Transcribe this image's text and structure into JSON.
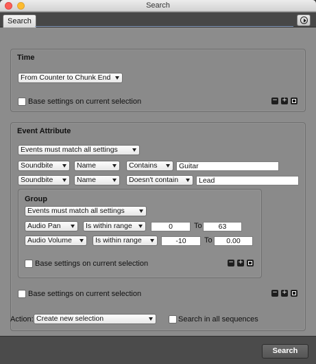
{
  "window": {
    "title": "Search"
  },
  "tab": {
    "label": "Search"
  },
  "time": {
    "title": "Time",
    "range_select": "From Counter to Chunk End",
    "base_settings_label": "Base settings on current selection"
  },
  "event_attribute": {
    "title": "Event Attribute",
    "match_select": "Events must match all settings",
    "rows": [
      {
        "type": "Soundbite",
        "field": "Name",
        "operator": "Contains",
        "value": "Guitar"
      },
      {
        "type": "Soundbite",
        "field": "Name",
        "operator": "Doesn't contain",
        "value": "Lead"
      }
    ],
    "base_settings_label": "Base settings on current selection"
  },
  "group": {
    "title": "Group",
    "match_select": "Events must match all settings",
    "rows": [
      {
        "param": "Audio Pan",
        "condition": "Is within range",
        "from": "0",
        "to_label": "To",
        "to": "63"
      },
      {
        "param": "Audio Volume",
        "condition": "Is within range",
        "from": "-10",
        "to_label": "To",
        "to": "0.00"
      }
    ],
    "base_settings_label": "Base settings on current selection"
  },
  "action": {
    "label": "Action:",
    "select": "Create new selection",
    "search_all_label": "Search in all sequences"
  },
  "footer": {
    "search_button": "Search"
  },
  "icons": {
    "minus": "−",
    "plus": "+"
  }
}
